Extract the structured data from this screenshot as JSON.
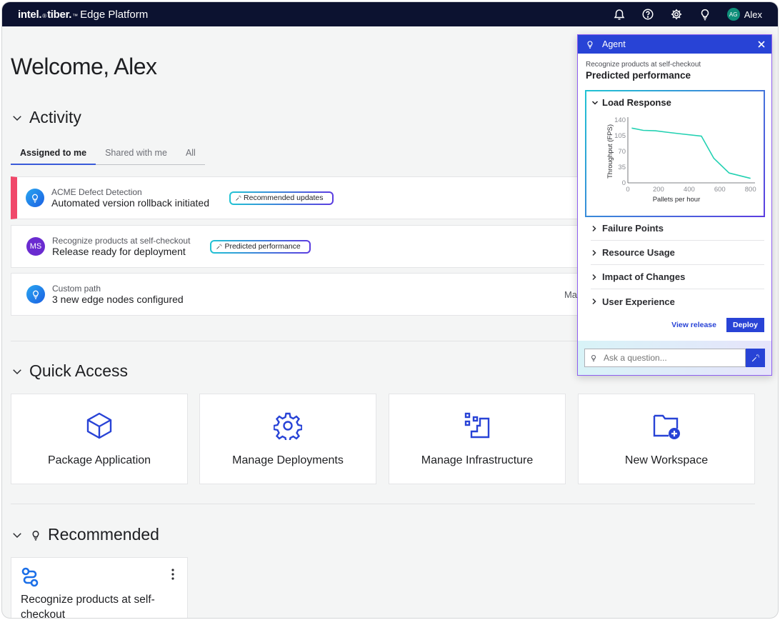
{
  "header": {
    "brand_intel": "intel.",
    "brand_intel_mark": "®",
    "brand_tiber": "tiber.",
    "brand_tiber_mark": "™",
    "brand_product": "Edge Platform",
    "user_initials": "AG",
    "user_name": "Alex"
  },
  "welcome": "Welcome, Alex",
  "activity": {
    "title": "Activity",
    "tabs": [
      {
        "label": "Assigned to me",
        "active": true
      },
      {
        "label": "Shared with me",
        "active": false
      },
      {
        "label": "All",
        "active": false
      }
    ],
    "items": [
      {
        "sub": "ACME  Defect Detection",
        "main": "Automated version rollback initiated",
        "pill": "Recommended updates",
        "trail": ""
      },
      {
        "avatar": "MS",
        "sub": "Recognize products at self-checkout",
        "main": "Release ready for deployment",
        "pill": "Predicted performance",
        "trail": ""
      },
      {
        "sub": "Custom path",
        "main": "3 new edge nodes configured",
        "trail": "Ma"
      }
    ]
  },
  "quick_access": {
    "title": "Quick Access",
    "items": [
      "Package Application",
      "Manage Deployments",
      "Manage Infrastructure",
      "New Workspace"
    ]
  },
  "recommended": {
    "title": "Recommended",
    "card_title": "Recognize products at self-checkout"
  },
  "agent": {
    "title": "Agent",
    "subtitle": "Recognize products at self-checkout",
    "heading": "Predicted performance",
    "sections": [
      "Load Response",
      "Failure Points",
      "Resource Usage",
      "Impact of Changes",
      "User Experience"
    ],
    "view_release": "View release",
    "deploy": "Deploy",
    "ask_placeholder": "Ask a question..."
  },
  "chart_data": {
    "type": "line",
    "title": "Load Response",
    "xlabel": "Pallets per hour",
    "ylabel": "Throughput (FPS)",
    "xlim": [
      0,
      820
    ],
    "ylim": [
      0,
      140
    ],
    "xticks": [
      0,
      200,
      400,
      600,
      800
    ],
    "yticks": [
      0,
      35,
      70,
      105,
      140
    ],
    "series": [
      {
        "color": "#22d1b2",
        "x": [
          25,
          100,
          180,
          250,
          350,
          480,
          560,
          660,
          800
        ],
        "y": [
          122,
          117,
          116,
          113,
          109,
          104,
          55,
          22,
          10
        ]
      }
    ]
  },
  "colors": {
    "navbar": "#0c1230",
    "accent": "#2843d6",
    "alert": "#f0486a",
    "chart_line": "#22d1b2"
  }
}
